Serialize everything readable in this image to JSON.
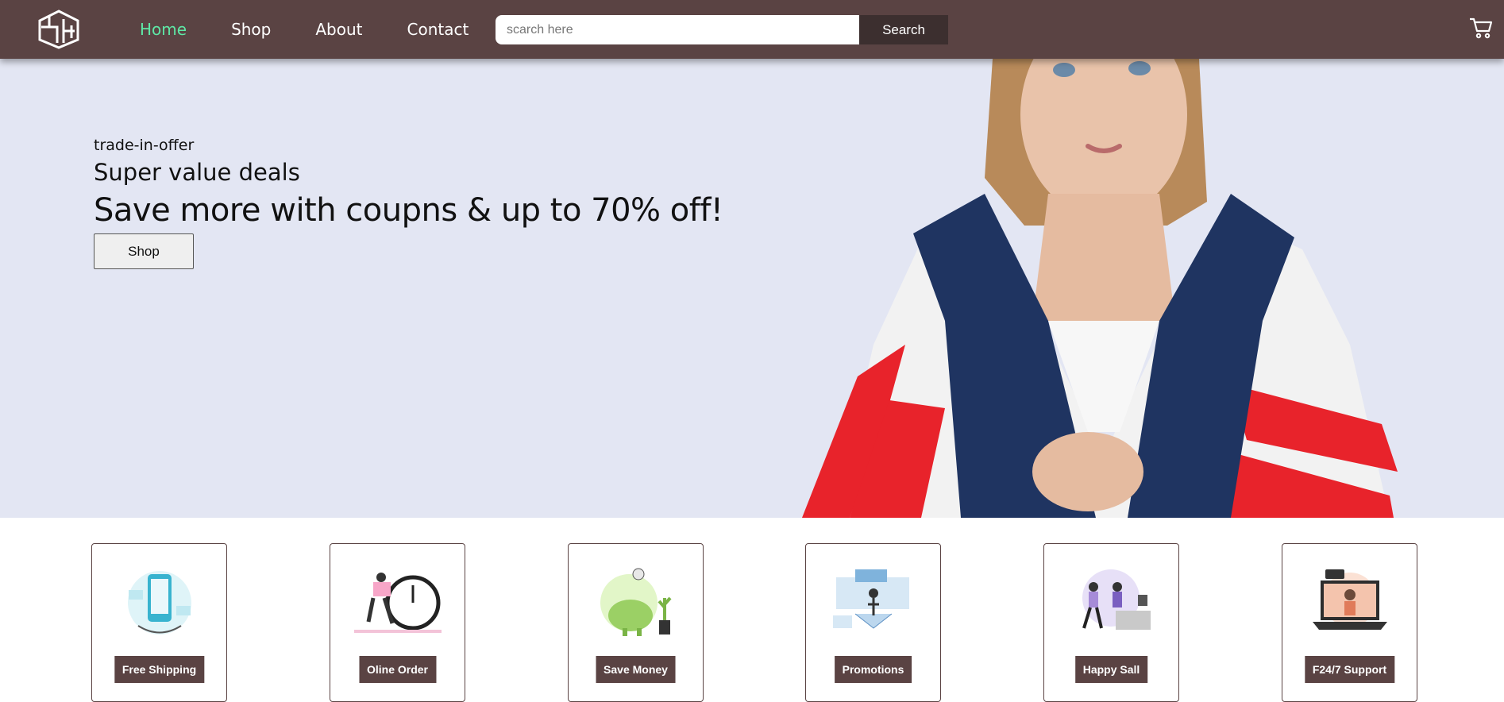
{
  "nav": {
    "links": [
      {
        "label": "Home",
        "active": true
      },
      {
        "label": "Shop"
      },
      {
        "label": "About"
      },
      {
        "label": "Contact"
      }
    ],
    "search": {
      "placeholder": "scarch here",
      "button_label": "Search"
    },
    "icons": {
      "logo": "cube-logo-icon",
      "cart": "cart-icon"
    }
  },
  "hero": {
    "kicker": "trade-in-offer",
    "subtitle": "Super value deals",
    "title": "Save more with coupns & up to 70% off!",
    "button_label": "Shop"
  },
  "features": [
    {
      "label": "Free Shipping",
      "icon": "shipping-icon"
    },
    {
      "label": "Oline Order",
      "icon": "order-icon"
    },
    {
      "label": "Save Money",
      "icon": "piggy-bank-icon"
    },
    {
      "label": "Promotions",
      "icon": "promotions-icon"
    },
    {
      "label": "Happy Sall",
      "icon": "happy-sale-icon"
    },
    {
      "label": "F24/7 Support",
      "icon": "support-icon"
    }
  ],
  "colors": {
    "nav_bg": "#5a4343",
    "nav_active": "#5ee8a6",
    "hero_bg": "#e3e6f3",
    "search_button": "#3c2f2f",
    "feature_label_bg": "#5a4343"
  }
}
